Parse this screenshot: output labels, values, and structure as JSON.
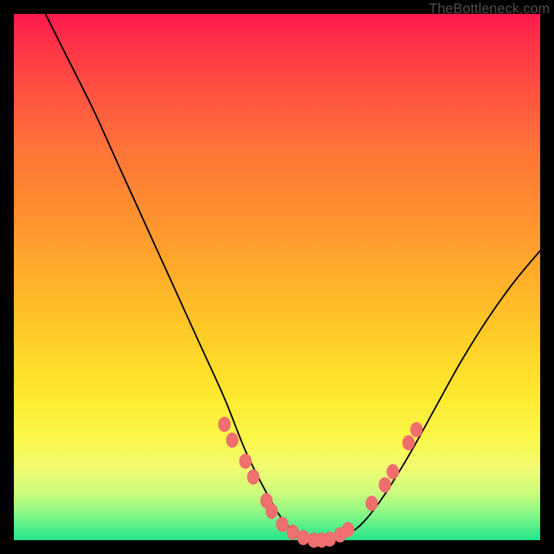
{
  "watermark": "TheBottleneck.com",
  "chart_data": {
    "type": "line",
    "title": "",
    "xlabel": "",
    "ylabel": "",
    "xlim": [
      0,
      100
    ],
    "ylim": [
      0,
      100
    ],
    "series": [
      {
        "name": "curve",
        "x": [
          6,
          10,
          15,
          20,
          25,
          30,
          35,
          40,
          44,
          48,
          51,
          54,
          57,
          60,
          63,
          66,
          70,
          75,
          80,
          85,
          90,
          95,
          100
        ],
        "y": [
          100,
          92,
          82,
          71,
          60,
          49,
          38,
          27,
          17,
          9,
          4,
          1,
          0,
          0,
          1,
          3,
          8,
          16,
          25,
          34,
          42,
          49,
          55
        ]
      }
    ],
    "markers": [
      {
        "x": 40.0,
        "y": 22.0
      },
      {
        "x": 41.5,
        "y": 19.0
      },
      {
        "x": 44.0,
        "y": 15.0
      },
      {
        "x": 45.5,
        "y": 12.0
      },
      {
        "x": 48.0,
        "y": 7.5
      },
      {
        "x": 49.0,
        "y": 5.5
      },
      {
        "x": 51.0,
        "y": 3.0
      },
      {
        "x": 53.0,
        "y": 1.5
      },
      {
        "x": 55.0,
        "y": 0.5
      },
      {
        "x": 57.0,
        "y": 0.0
      },
      {
        "x": 58.5,
        "y": 0.0
      },
      {
        "x": 60.0,
        "y": 0.2
      },
      {
        "x": 62.0,
        "y": 1.0
      },
      {
        "x": 63.5,
        "y": 2.0
      },
      {
        "x": 68.0,
        "y": 7.0
      },
      {
        "x": 70.5,
        "y": 10.5
      },
      {
        "x": 72.0,
        "y": 13.0
      },
      {
        "x": 75.0,
        "y": 18.5
      },
      {
        "x": 76.5,
        "y": 21.0
      }
    ],
    "marker_color": "#ef6e6e",
    "curve_color": "#000000"
  }
}
